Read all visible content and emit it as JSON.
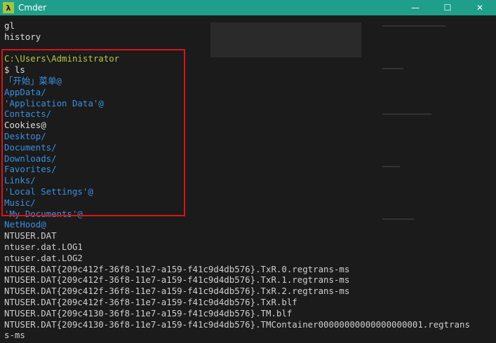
{
  "window": {
    "icon_glyph": "λ",
    "title": "Cmder",
    "buttons": {
      "minimize": "—",
      "maximize": "☐",
      "close": "✕"
    }
  },
  "terminal": {
    "lines": [
      {
        "text": "gl",
        "style": "white"
      },
      {
        "text": "history",
        "style": "white"
      },
      {
        "text": "",
        "style": "white"
      },
      {
        "text": "C:\\Users\\Administrator",
        "style": "green"
      },
      {
        "text": "$ ls",
        "style": "white"
      },
      {
        "text": "「开始」菜单@",
        "style": "blue",
        "suffix": "@"
      },
      {
        "text": "AppData/",
        "style": "blue"
      },
      {
        "text": "'Application Data'@",
        "style": "blue"
      },
      {
        "text": "Contacts/",
        "style": "blue"
      },
      {
        "text": "Cookies@",
        "style": "white"
      },
      {
        "text": "Desktop/",
        "style": "blue"
      },
      {
        "text": "Documents/",
        "style": "blue"
      },
      {
        "text": "Downloads/",
        "style": "blue"
      },
      {
        "text": "Favorites/",
        "style": "blue"
      },
      {
        "text": "Links/",
        "style": "blue"
      },
      {
        "text": "'Local Settings'@",
        "style": "blue"
      },
      {
        "text": "Music/",
        "style": "blue"
      },
      {
        "text": "'My Documents'@",
        "style": "blue"
      },
      {
        "text": "NetHood@",
        "style": "blue"
      },
      {
        "text": "NTUSER.DAT",
        "style": "light"
      },
      {
        "text": "ntuser.dat.LOG1",
        "style": "light"
      },
      {
        "text": "ntuser.dat.LOG2",
        "style": "light"
      },
      {
        "text": "NTUSER.DAT{209c412f-36f8-11e7-a159-f41c9d4db576}.TxR.0.regtrans-ms",
        "style": "light"
      },
      {
        "text": "NTUSER.DAT{209c412f-36f8-11e7-a159-f41c9d4db576}.TxR.1.regtrans-ms",
        "style": "light"
      },
      {
        "text": "NTUSER.DAT{209c412f-36f8-11e7-a159-f41c9d4db576}.TxR.2.regtrans-ms",
        "style": "light"
      },
      {
        "text": "NTUSER.DAT{209c412f-36f8-11e7-a159-f41c9d4db576}.TxR.blf",
        "style": "light"
      },
      {
        "text": "NTUSER.DAT{209c4130-36f8-11e7-a159-f41c9d4db576}.TM.blf",
        "style": "light"
      },
      {
        "text": "NTUSER.DAT{209c4130-36f8-11e7-a159-f41c9d4db576}.TMContainer00000000000000000001.regtrans",
        "style": "light"
      },
      {
        "text": "s-ms",
        "style": "light"
      }
    ]
  },
  "colors": {
    "titlebar": "#1f9e8c",
    "prompt_path": "#b5c744",
    "directory": "#3a8fe0",
    "text": "#dedede",
    "highlight_border": "#d91414"
  }
}
